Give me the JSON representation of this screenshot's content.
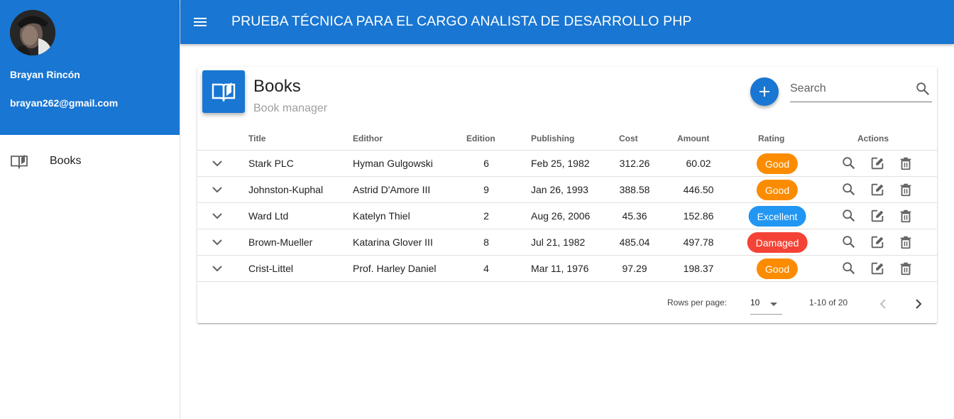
{
  "appbar": {
    "title": "PRUEBA TÉCNICA PARA EL CARGO ANALISTA DE DESARROLLO PHP"
  },
  "user": {
    "name": "Brayan Rincón",
    "email": "brayan262@gmail.com"
  },
  "sidebar": {
    "items": [
      {
        "label": "Books",
        "icon": "book-open-icon"
      }
    ]
  },
  "card": {
    "title": "Books",
    "subtitle": "Book manager",
    "search_placeholder": "Search"
  },
  "table": {
    "headers": {
      "title": "Title",
      "editor": "Edithor",
      "edition": "Edition",
      "publishing": "Publishing",
      "cost": "Cost",
      "amount": "Amount",
      "rating": "Rating",
      "actions": "Actions"
    },
    "rows": [
      {
        "title": "Stark PLC",
        "editor": "Hyman Gulgowski",
        "edition": "6",
        "publishing": "Feb 25, 1982",
        "cost": "312.26",
        "amount": "60.02",
        "rating": "Good",
        "rating_color": "#fb8c00"
      },
      {
        "title": "Johnston-Kuphal",
        "editor": "Astrid D'Amore III",
        "edition": "9",
        "publishing": "Jan 26, 1993",
        "cost": "388.58",
        "amount": "446.50",
        "rating": "Good",
        "rating_color": "#fb8c00"
      },
      {
        "title": "Ward Ltd",
        "editor": "Katelyn Thiel",
        "edition": "2",
        "publishing": "Aug 26, 2006",
        "cost": "45.36",
        "amount": "152.86",
        "rating": "Excellent",
        "rating_color": "#2196f3"
      },
      {
        "title": "Brown-Mueller",
        "editor": "Katarina Glover III",
        "edition": "8",
        "publishing": "Jul 21, 1982",
        "cost": "485.04",
        "amount": "497.78",
        "rating": "Damaged",
        "rating_color": "#f44336"
      },
      {
        "title": "Crist-Littel",
        "editor": "Prof. Harley Daniel",
        "edition": "4",
        "publishing": "Mar 11, 1976",
        "cost": "97.29",
        "amount": "198.37",
        "rating": "Good",
        "rating_color": "#fb8c00"
      }
    ]
  },
  "footer": {
    "rows_per_page_label": "Rows per page:",
    "rows_per_page_value": "10",
    "range": "1-10 of 20"
  },
  "colors": {
    "primary": "#1976d2",
    "good": "#fb8c00",
    "excellent": "#2196f3",
    "damaged": "#f44336"
  }
}
